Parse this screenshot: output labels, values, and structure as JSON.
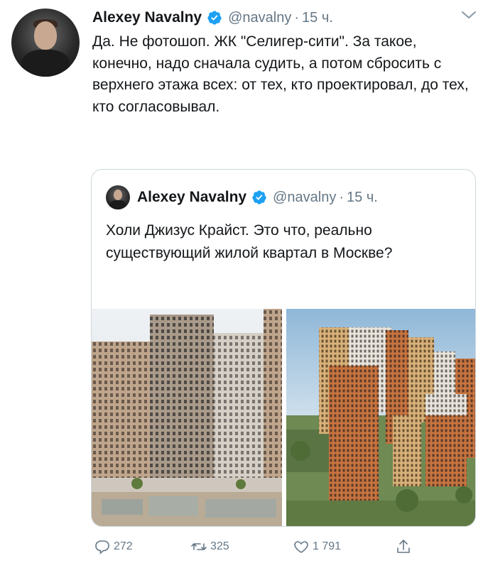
{
  "tweet": {
    "author_name": "Alexey Navalny",
    "handle": "@navalny",
    "separator": "·",
    "time": "15 ч.",
    "text": "Да. Не фотошоп. ЖК \"Селигер-сити\". За такое, конечно, надо сначала судить, а потом сбросить с верхнего этажа всех: от тех, кто проектировал, до тех, кто согласовывал."
  },
  "quoted_tweet": {
    "author_name": "Alexey Navalny",
    "handle": "@navalny",
    "separator": "·",
    "time": "15 ч.",
    "text": "Холи Джизус Крайст. Это что, реально существующий жилой квартал в Москве?"
  },
  "actions": {
    "reply_count": "272",
    "retweet_count": "325",
    "like_count": "1 791"
  },
  "icons": {
    "verified": "verified-badge-icon",
    "menu": "chevron-down-icon",
    "reply": "reply-icon",
    "retweet": "retweet-icon",
    "like": "heart-icon",
    "share": "share-icon"
  },
  "colors": {
    "verified": "#1da1f2",
    "secondary_text": "#657786",
    "border": "#cfd9de"
  }
}
